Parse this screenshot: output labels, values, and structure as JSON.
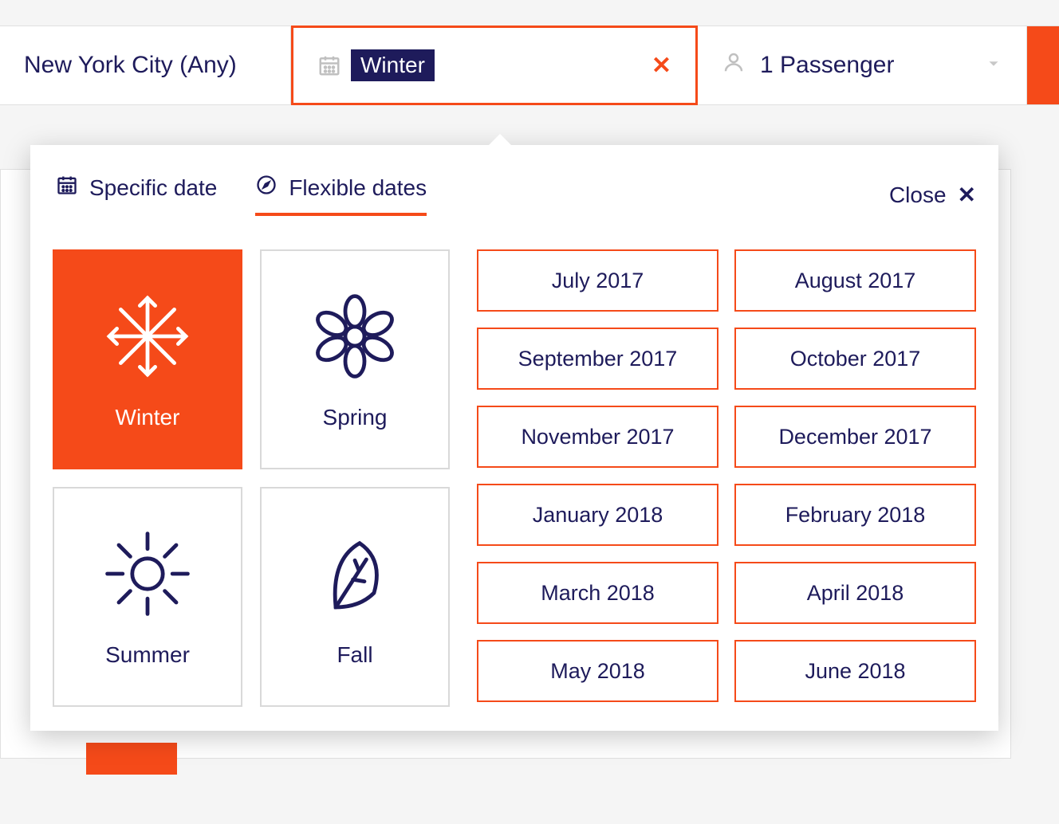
{
  "search": {
    "destination": "New York City (Any)",
    "date_label": "Winter",
    "passengers_label": "1 Passenger"
  },
  "popover": {
    "tabs": {
      "specific": "Specific date",
      "flexible": "Flexible dates"
    },
    "close_label": "Close",
    "seasons": [
      {
        "label": "Winter",
        "selected": true
      },
      {
        "label": "Spring",
        "selected": false
      },
      {
        "label": "Summer",
        "selected": false
      },
      {
        "label": "Fall",
        "selected": false
      }
    ],
    "months": [
      "July 2017",
      "August 2017",
      "September 2017",
      "October 2017",
      "November 2017",
      "December 2017",
      "January 2018",
      "February 2018",
      "March 2018",
      "April 2018",
      "May 2018",
      "June 2018"
    ]
  },
  "colors": {
    "accent": "#f54a19",
    "navy": "#1e1b5b"
  }
}
